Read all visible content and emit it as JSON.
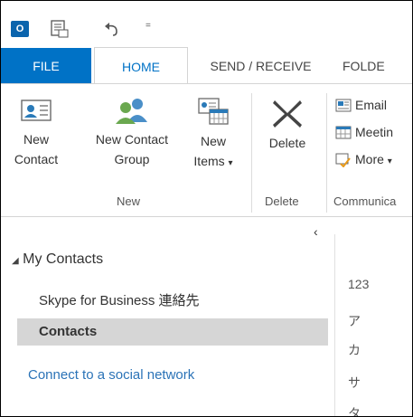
{
  "qat": {
    "logo_text": "O",
    "icons": [
      "outlook-logo-icon",
      "send-receive-all-icon",
      "undo-icon",
      "customize-qat-icon"
    ],
    "dropdown_glyph": "="
  },
  "tabs": {
    "file": "FILE",
    "home": "HOME",
    "send_receive": "SEND / RECEIVE",
    "folder": "FOLDE"
  },
  "ribbon": {
    "new_contact": [
      "New",
      "Contact"
    ],
    "new_contact_group": [
      "New Contact",
      "Group"
    ],
    "new_items": [
      "New",
      "Items"
    ],
    "new_items_arrow": "▾",
    "group_new": "New",
    "delete": "Delete",
    "group_delete": "Delete",
    "email": "Email",
    "meeting": "Meetin",
    "more": "More",
    "more_arrow": "▾",
    "group_communicate": "Communica"
  },
  "nav": {
    "collapse_glyph": "‹",
    "section_arrow": "◢",
    "section": "My Contacts",
    "items": [
      "Skype for Business 連絡先",
      "Contacts"
    ],
    "social_link": "Connect to a social network"
  },
  "alpha_index": [
    "123",
    "ア",
    "カ",
    "サ",
    "タ"
  ],
  "colors": {
    "accent": "#0072c6",
    "selected_bg": "#d6d6d6",
    "link": "#2b73b7"
  }
}
